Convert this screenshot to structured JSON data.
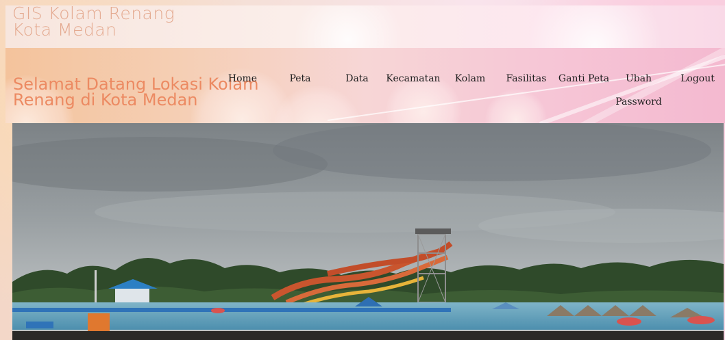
{
  "site": {
    "title": "GIS Kolam Renang Kota Medan",
    "welcome": "Selamat Datang Lokasi Kolam Renang di Kota Medan"
  },
  "nav": {
    "items": [
      {
        "id": "home",
        "label": "Home"
      },
      {
        "id": "peta",
        "label": "Peta"
      },
      {
        "id": "data",
        "label": "Data"
      },
      {
        "id": "kecamatan",
        "label": "Kecamatan"
      },
      {
        "id": "kolam",
        "label": "Kolam"
      },
      {
        "id": "fasilitas",
        "label": "Fasilitas"
      },
      {
        "id": "ganti-peta",
        "label": "Ganti Peta"
      },
      {
        "id": "ubah-password",
        "label": "Ubah Password"
      },
      {
        "id": "logout",
        "label": "Logout"
      }
    ]
  },
  "colors": {
    "title_text": "#e4a98f",
    "welcome_text": "#ec8a62",
    "nav_text": "#1f1f1f"
  },
  "hero": {
    "icon": "waterpark-photo"
  }
}
